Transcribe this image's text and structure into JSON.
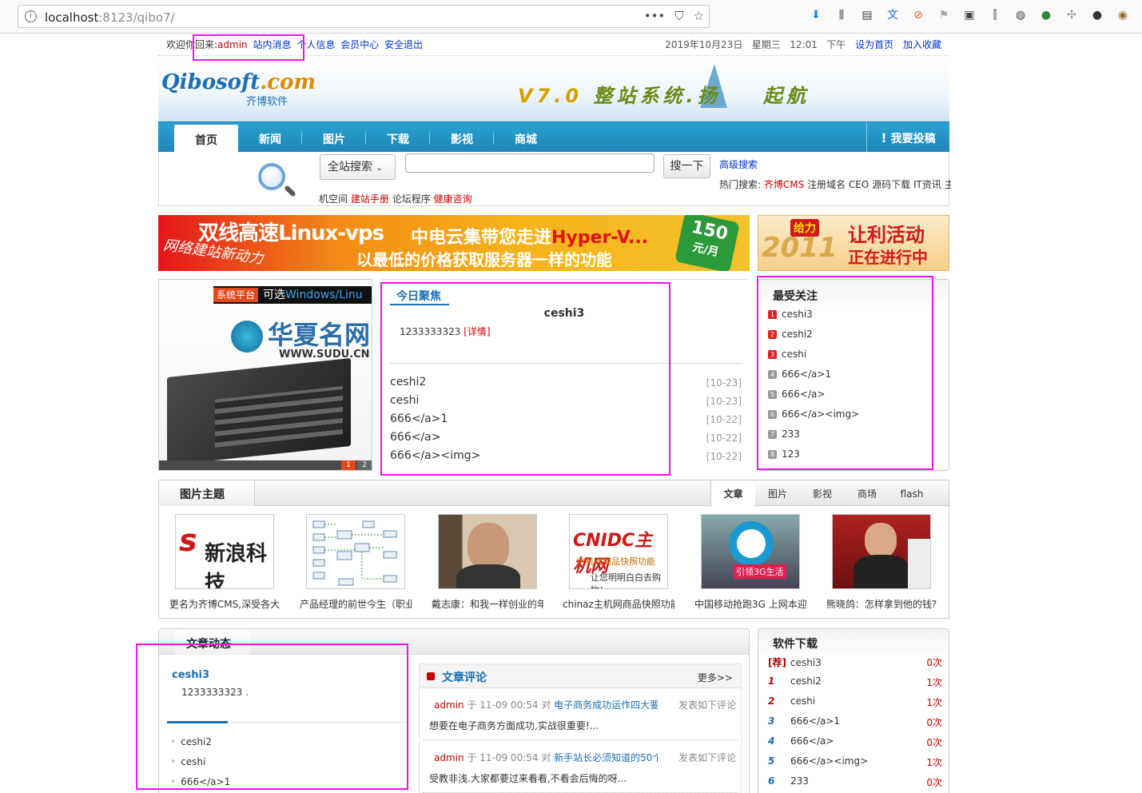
{
  "browser": {
    "url_host": "localhost",
    "url_rest": ":8123/qibo7/",
    "url_menu": "•••"
  },
  "topbar": {
    "welcome": "欢迎你回来:",
    "user": "admin",
    "links": [
      "站内消息",
      "个人信息",
      "会员中心",
      "安全退出"
    ],
    "date": "2019年10月23日",
    "weekday": "星期三",
    "time": "12:01",
    "ampm": "下午",
    "set_home": "设为首页",
    "add_fav": "加入收藏"
  },
  "header": {
    "logo_main": "Qibosoft",
    "logo_com": ".com",
    "logo_sub": "齐博软件",
    "slogan_ver": "V7.0",
    "slogan_text": "整站系统.扬",
    "slogan_tail": "起航"
  },
  "nav": {
    "items": [
      "首页",
      "新闻",
      "图片",
      "下载",
      "影视",
      "商城"
    ],
    "contribute": "我要投稿"
  },
  "search": {
    "scope": "全站搜索",
    "button": "搜一下",
    "advanced": "高级搜索",
    "hot_label": "热门搜索:",
    "hot_items": [
      "齐博CMS",
      "注册域名",
      "CEO",
      "源码下载",
      "IT资讯",
      "主"
    ],
    "sub_links": [
      "机空间",
      "建站手册",
      "论坛程序",
      "健康咨询"
    ]
  },
  "banners": {
    "b1_line1": "双线高速Linux-vps",
    "b1_line2a": "中电云集带您走进",
    "b1_line2b": "Hyper-V...",
    "b1_line3": "以最低的价格获取服务器一样的功能",
    "b1_slogan": "网络建站新动力",
    "b1_price": "150",
    "b1_unit": "元/月",
    "b2_year": "2011",
    "b2_badge": "给力",
    "b2_line1": "让利活动",
    "b2_line2": "正在进行中"
  },
  "slide": {
    "tag": "系统平台",
    "caption_a": "可选",
    "caption_b": "Windows/Linu",
    "brand": "华夏名网",
    "site": "WWW.SUDU.CN",
    "pages": [
      "1",
      "2"
    ]
  },
  "focus": {
    "title": "今日聚焦",
    "headline": "ceshi3",
    "desc": "1233333323",
    "detail": "[详情]",
    "items": [
      {
        "t": "ceshi2",
        "d": "[10-23]"
      },
      {
        "t": "ceshi",
        "d": "[10-23]"
      },
      {
        "t": "666</a>1",
        "d": "[10-22]"
      },
      {
        "t": "666</a>",
        "d": "[10-22]"
      },
      {
        "t": "666</a><img>",
        "d": "[10-22]"
      }
    ]
  },
  "hot": {
    "title": "最受关注",
    "items": [
      "ceshi3",
      "ceshi2",
      "ceshi",
      "666</a>1",
      "666</a>",
      "666</a><img>",
      "233",
      "123"
    ]
  },
  "pics": {
    "title": "图片主题",
    "tabs": [
      "文章",
      "图片",
      "影视",
      "商场",
      "flash"
    ],
    "cards": [
      {
        "cap": "更名为齐博CMS,深受各大",
        "img": "新浪科技"
      },
      {
        "cap": "产品经理的前世今生（职业",
        "img": "diagram"
      },
      {
        "cap": "戴志康：和我一样创业的年",
        "img": "portrait"
      },
      {
        "cap": "chinaz主机网商品快照功能",
        "img": "CNIDC主机网"
      },
      {
        "cap": "中国移动抢跑3G 上网本迎",
        "img": "引领3G生活"
      },
      {
        "cap": "熊晓鸽：怎样拿到他的钱?",
        "img": "speaker"
      }
    ],
    "cnidc_sub1": "主机网商品快照功能",
    "cnidc_sub2": "让您明明白白去购物！"
  },
  "news": {
    "title": "文章动态",
    "headline": "ceshi3",
    "desc": "1233333323 .",
    "items": [
      "ceshi2",
      "ceshi",
      "666</a>1"
    ]
  },
  "comments": {
    "title": "文章评论",
    "more": "更多>>",
    "entries": [
      {
        "user": "admin",
        "time": "于 11-09 00:54 对",
        "topic": "电子商务成功运作四大要",
        "said": "发表如下评论",
        "body": "想要在电子商务方面成功,实战很重要!..."
      },
      {
        "user": "admin",
        "time": "于 11-09 00:54 对",
        "topic": "新手站长必须知道的50个",
        "said": "发表如下评论",
        "body": "受教非浅.大家都要过来看看,不看会后悔的呀..."
      }
    ]
  },
  "soft": {
    "title": "软件下载",
    "items": [
      {
        "k": "[荐]",
        "t": "ceshi3",
        "c": "0次"
      },
      {
        "k": "1",
        "t": "ceshi2",
        "c": "1次"
      },
      {
        "k": "2",
        "t": "ceshi",
        "c": "1次"
      },
      {
        "k": "3",
        "t": "666</a>1",
        "c": "0次"
      },
      {
        "k": "4",
        "t": "666</a>",
        "c": "0次"
      },
      {
        "k": "5",
        "t": "666</a><img>",
        "c": "1次"
      },
      {
        "k": "6",
        "t": "233",
        "c": "0次"
      }
    ]
  },
  "colors": {
    "accent": "#1a6fb4",
    "nav": "#1f86b8",
    "highlight": "#ee14ee",
    "red": "#cc0000"
  }
}
